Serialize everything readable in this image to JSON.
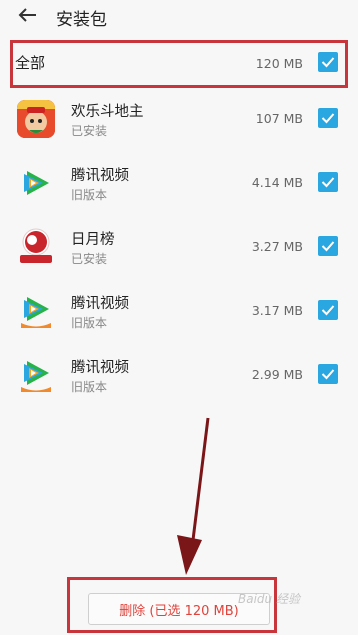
{
  "header": {
    "title": "安装包"
  },
  "all": {
    "label": "全部",
    "size": "120 MB"
  },
  "items": [
    {
      "name": "欢乐斗地主",
      "status": "已安装",
      "size": "107 MB",
      "icon": "doudizhu-app-icon"
    },
    {
      "name": "腾讯视频",
      "status": "旧版本",
      "size": "4.14 MB",
      "icon": "tencent-video-icon"
    },
    {
      "name": "日月榜",
      "status": "已安装",
      "size": "3.27 MB",
      "icon": "riyuebang-app-icon"
    },
    {
      "name": "腾讯视频",
      "status": "旧版本",
      "size": "3.17 MB",
      "icon": "tencent-video-icon"
    },
    {
      "name": "腾讯视频",
      "status": "旧版本",
      "size": "2.99 MB",
      "icon": "tencent-video-icon"
    }
  ],
  "footer": {
    "delete_label": "删除 (已选 120 MB)"
  },
  "watermark": "Baidu 经验",
  "colors": {
    "accent": "#2aa6e0",
    "highlight": "#c8363b",
    "delete": "#e0433b"
  }
}
